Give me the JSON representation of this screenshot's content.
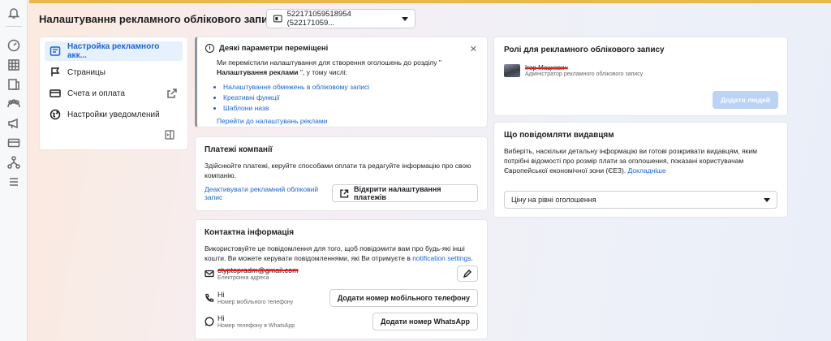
{
  "header": {
    "title": "Налаштування рекламного облікового запису",
    "account_selector": "522171059518954 (522171059..."
  },
  "rail": {
    "icons": [
      "bell-icon",
      "dashboard-icon",
      "table-icon",
      "pages-icon",
      "people-icon",
      "megaphone-icon",
      "card-icon",
      "flow-icon",
      "menu-icon"
    ]
  },
  "nav": {
    "items": [
      {
        "label": "Настройка рекламного акк...",
        "icon": "ad-account-icon",
        "active": true
      },
      {
        "label": "Страницы",
        "icon": "page-icon"
      },
      {
        "label": "Счета и оплата",
        "icon": "billing-icon",
        "external": true
      },
      {
        "label": "Настройки уведомлений",
        "icon": "globe-icon"
      }
    ]
  },
  "notice": {
    "title": "Деякі параметри переміщені",
    "body_prefix": "Ми перемістили налаштування для створення оголошень до розділу \"",
    "body_bold": "Налаштування реклами",
    "body_suffix": " \", у тому числі:",
    "links": [
      "Налаштування обмежень в обліковому записі",
      "Креативні функції",
      "Шаблони назв"
    ],
    "go_link": "Перейти до налаштувань реклами"
  },
  "payments": {
    "title": "Платежі компанії",
    "text": "Здійснюйте платежі, керуйте способами оплати та редагуйте інформацію про свою компанію.",
    "deactivate_link": "Деактивувати рекламний обліковий запис",
    "open_button": "Відкрити налаштування платежів"
  },
  "contact": {
    "title": "Контактна інформація",
    "text_prefix": "Використовуйте це повідомлення для того, щоб повідомити вам про будь-які інші кошти. Ви можете керувати повідомленнями, які Ви отримуєте в ",
    "text_link": "notification settings",
    "text_suffix": ".",
    "email_value": "ctyptopradm@gmail.com",
    "email_label": "Електронна адреса",
    "phone_value": "Hi",
    "phone_label": "Номер мобільного телефону",
    "phone_button": "Додати номер мобільного телефону",
    "whatsapp_value": "Hi",
    "whatsapp_label": "Номер телефону в WhatsApp",
    "whatsapp_button": "Додати номер WhatsApp"
  },
  "roles": {
    "title": "Ролі для рекламного облікового запису",
    "person_name": "Ігор Мацкевич",
    "person_role": "Адміністратор рекламного облікового запису",
    "add_button": "Додати людей"
  },
  "vendors": {
    "title": "Що повідомляти видавцям",
    "text": "Виберіть, наскільки детальну інформацію ви готові розкривати видавцям, яким потрібні відомості про розмір плати за оголошення, показані користувачам Європейської економічної зони (ЄЕЗ). ",
    "more_link": "Докладніше",
    "select_value": "Ціну на рівні оголошення"
  }
}
